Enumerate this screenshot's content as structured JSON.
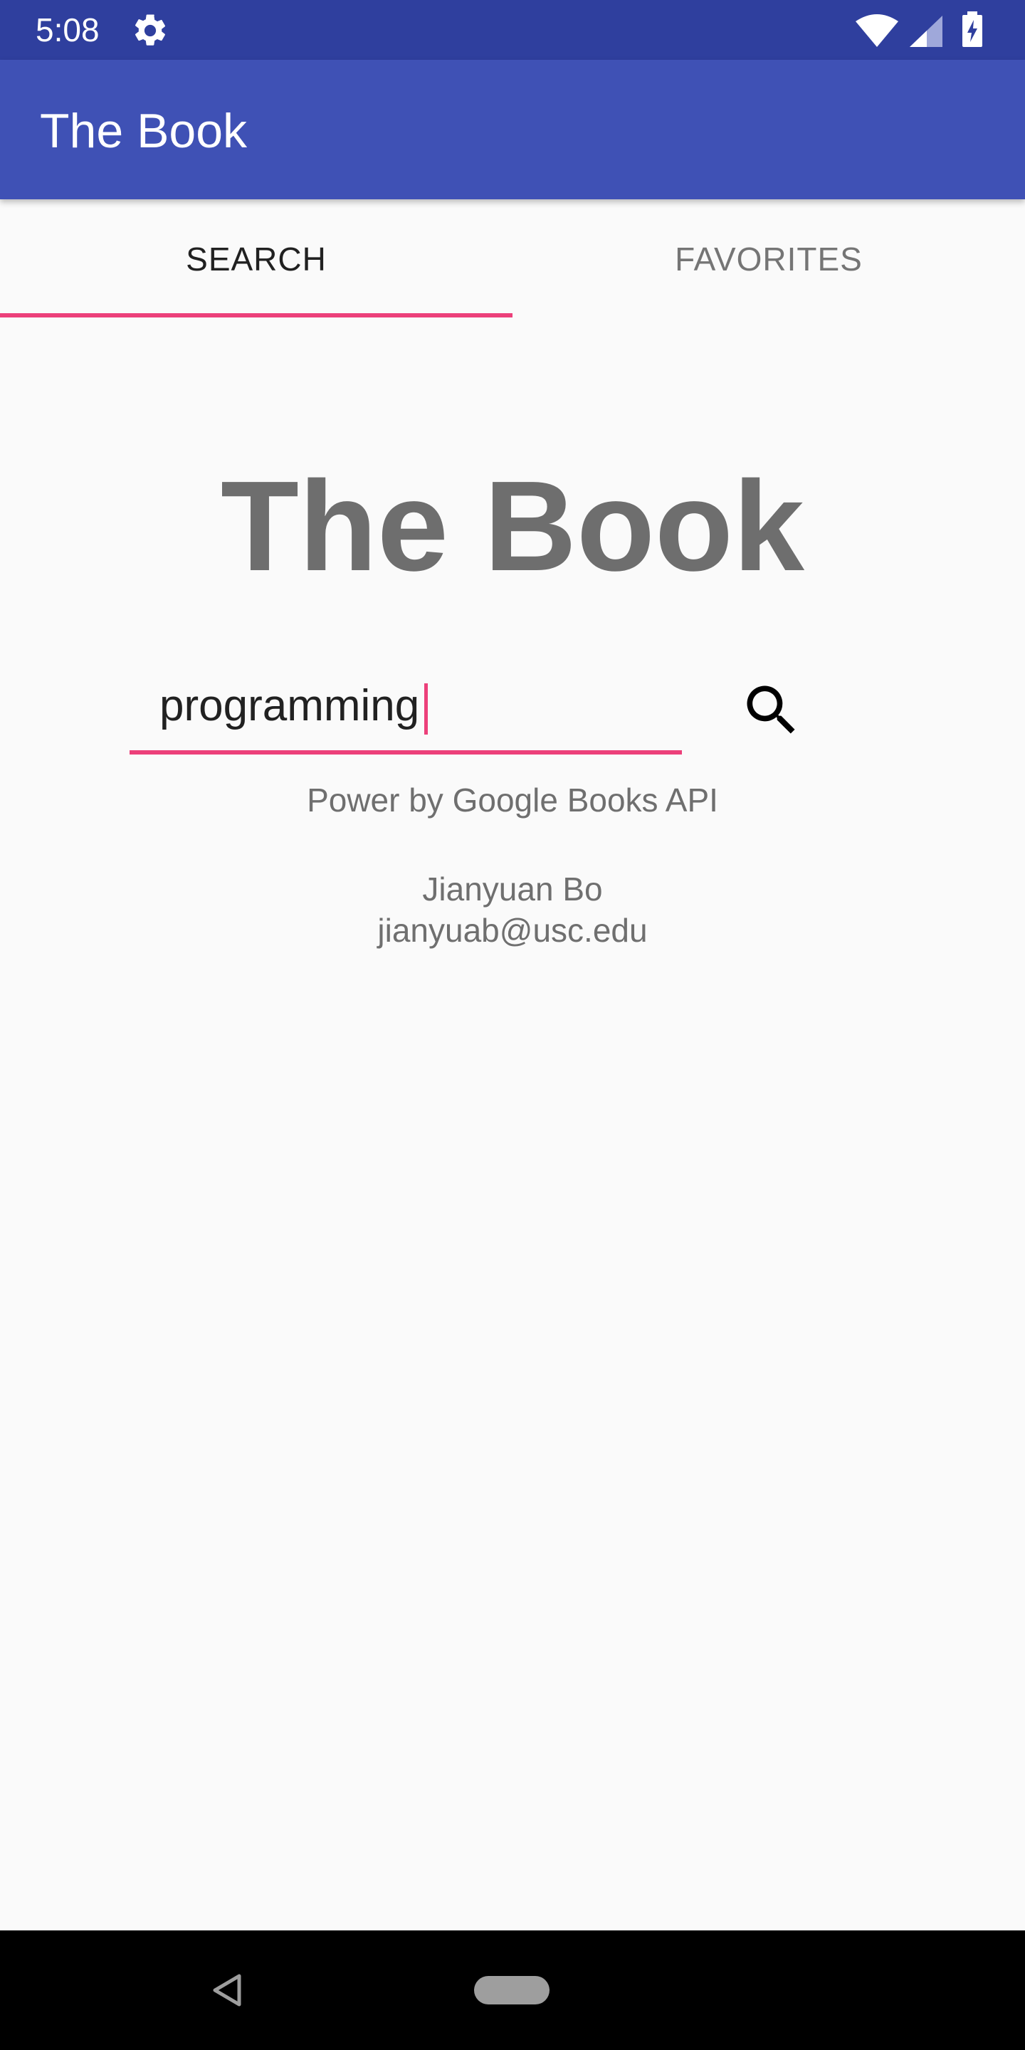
{
  "status_bar": {
    "time": "5:08",
    "icons": [
      "gear-icon",
      "wifi-icon",
      "signal-icon",
      "battery-icon"
    ]
  },
  "app_bar": {
    "title": "The Book",
    "color": "#3f51b5"
  },
  "tabs": [
    {
      "label": "SEARCH",
      "selected": true
    },
    {
      "label": "FAVORITES",
      "selected": false
    }
  ],
  "accent_color": "#ec407a",
  "main": {
    "title": "The Book",
    "search": {
      "value": "programming",
      "icon": "search-icon"
    },
    "powered_by": "Power by Google Books API",
    "author_name": "Jianyuan Bo",
    "author_email": "jianyuab@usc.edu"
  },
  "nav_bar": {
    "icons": [
      "back-icon",
      "home-icon"
    ]
  }
}
